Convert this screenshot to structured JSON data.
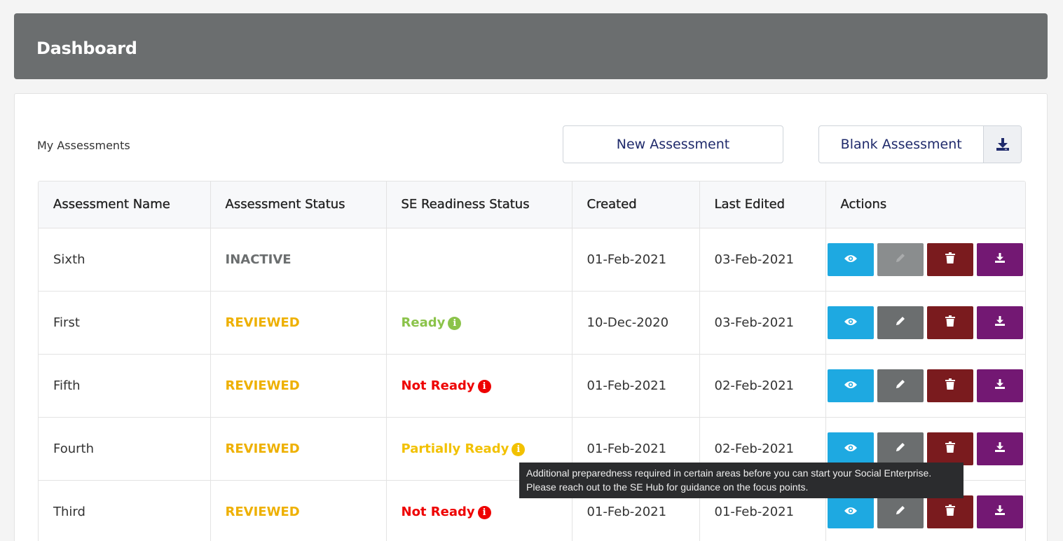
{
  "header": {
    "title": "Dashboard"
  },
  "section": {
    "title": "My Assessments",
    "new_button": "New Assessment",
    "blank_button": "Blank Assessment",
    "blank_icon": "download-icon"
  },
  "table": {
    "columns": [
      "Assessment Name",
      "Assessment Status",
      "SE Readiness Status",
      "Created",
      "Last Edited",
      "Actions"
    ],
    "rows": [
      {
        "name": "Sixth",
        "status": "INACTIVE",
        "readiness": "",
        "created": "01-Feb-2021",
        "edited": "03-Feb-2021"
      },
      {
        "name": "First",
        "status": "REVIEWED",
        "readiness": "Ready",
        "created": "10-Dec-2020",
        "edited": "03-Feb-2021"
      },
      {
        "name": "Fifth",
        "status": "REVIEWED",
        "readiness": "Not Ready",
        "created": "01-Feb-2021",
        "edited": "02-Feb-2021"
      },
      {
        "name": "Fourth",
        "status": "REVIEWED",
        "readiness": "Partially Ready",
        "created": "01-Feb-2021",
        "edited": "02-Feb-2021"
      },
      {
        "name": "Third",
        "status": "REVIEWED",
        "readiness": "Not Ready",
        "created": "01-Feb-2021",
        "edited": "01-Feb-2021"
      }
    ]
  },
  "tooltip": {
    "line1": "Additional preparedness required in certain areas before you can start your Social Enterprise.",
    "line2": "Please reach out to the SE Hub for guidance on the focus points."
  },
  "colors": {
    "header_bg": "#6b6e6f",
    "inactive": "#6b6e6f",
    "reviewed": "#eeb000",
    "ready": "#8bc34a",
    "not_ready": "#ee0000",
    "partially_ready": "#f2c100",
    "view_btn": "#1ea9e1",
    "edit_btn": "#6b6e6f",
    "delete_btn": "#7a1b1e",
    "download_btn": "#731873",
    "link_text": "#1f2a6b"
  }
}
